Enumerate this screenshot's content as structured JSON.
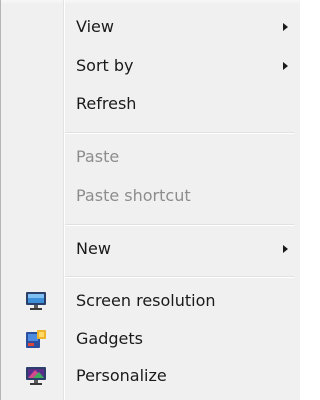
{
  "context_menu": {
    "items": [
      {
        "label": "View",
        "has_submenu": true,
        "enabled": true
      },
      {
        "label": "Sort by",
        "has_submenu": true,
        "enabled": true
      },
      {
        "label": "Refresh",
        "has_submenu": false,
        "enabled": true
      },
      {
        "label": "Paste",
        "has_submenu": false,
        "enabled": false
      },
      {
        "label": "Paste shortcut",
        "has_submenu": false,
        "enabled": false
      },
      {
        "label": "New",
        "has_submenu": true,
        "enabled": true
      },
      {
        "label": "Screen resolution",
        "has_submenu": false,
        "enabled": true,
        "icon": "monitor-icon"
      },
      {
        "label": "Gadgets",
        "has_submenu": false,
        "enabled": true,
        "icon": "gadgets-icon"
      },
      {
        "label": "Personalize",
        "has_submenu": false,
        "enabled": true,
        "icon": "personalize-icon"
      }
    ],
    "colors": {
      "background": "#f0f0f0",
      "text": "#1a1a1a",
      "disabled_text": "#8d8d8d"
    }
  }
}
